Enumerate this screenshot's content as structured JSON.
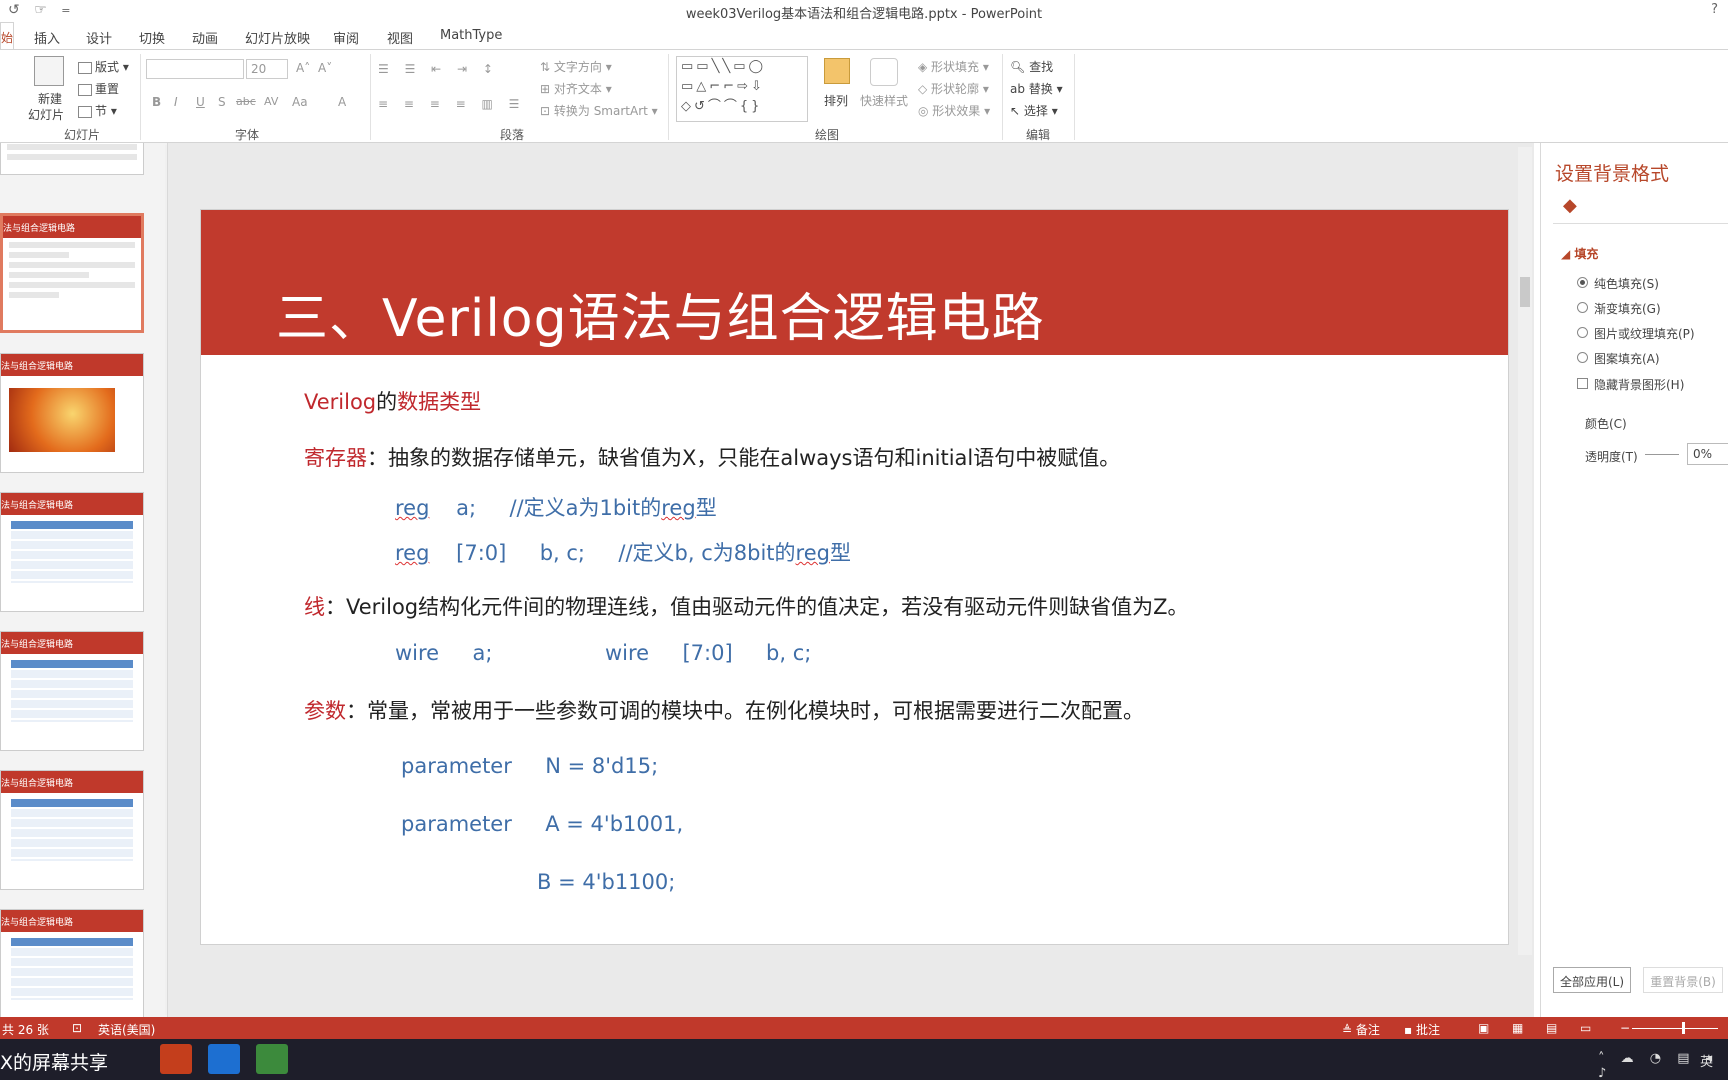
{
  "titlebar": {
    "undo": "↺",
    "quick": "☞",
    "more": "=",
    "title": "week03Verilog基本语法和组合逻辑电路.pptx - PowerPoint",
    "help": "?"
  },
  "tabs": [
    "插入",
    "设计",
    "切换",
    "动画",
    "幻灯片放映",
    "审阅",
    "视图",
    "MathType"
  ],
  "active_tab_fragment": "始",
  "ribbon": {
    "slides": {
      "new": "新建",
      "new2": "幻灯片",
      "layout": "版式",
      "reset": "重置",
      "section": "节",
      "label": "幻灯片"
    },
    "font": {
      "size": "20",
      "label": "字体",
      "bold": "B",
      "italic": "I",
      "underline": "U",
      "shadow": "S",
      "strike": "abc",
      "spacing": "AV",
      "case": "Aa",
      "color": "A",
      "grow": "A˄",
      "shrink": "A˅"
    },
    "paragraph": {
      "direction": "文字方向",
      "align": "对齐文本",
      "smartart": "转换为 SmartArt",
      "label": "段落"
    },
    "drawing": {
      "arrange": "排列",
      "quickstyle": "快速样式",
      "fill": "形状填充",
      "outline": "形状轮廓",
      "effect": "形状效果",
      "label": "绘图"
    },
    "editing": {
      "find": "查找",
      "replace": "替换",
      "select": "选择",
      "label": "编辑"
    }
  },
  "thumbs": {
    "title_frag": "法与组合逻辑电路"
  },
  "slide": {
    "title": "三、Verilog语法与组合逻辑电路",
    "heading_a": "Verilog",
    "heading_b": "的",
    "heading_c": "数据类型",
    "reg_label": "寄存器",
    "reg_desc": "：抽象的数据存储单元，缺省值为X，只能在always语句和initial语句中被赋值。",
    "reg1_kw": "reg",
    "reg1_rest": "    a;     //定义a为1bit的",
    "reg1_sq": "reg",
    "reg1_end": "型",
    "reg2_kw": "reg",
    "reg2_rest": "    [7:0]     b, c;     //定义b, c为8bit的",
    "reg2_sq": "reg",
    "reg2_end": "型",
    "wire_label": "线",
    "wire_desc": "：Verilog结构化元件间的物理连线，值由驱动元件的值决定，若没有驱动元件则缺省值为Z。",
    "wire_a": "wire     a;",
    "wire_b": "wire     [7:0]     b, c;",
    "param_label": "参数",
    "param_desc": "：常量，常被用于一些参数可调的模块中。在例化模块时，可根据需要进行二次配置。",
    "param1": "parameter     N = 8'd15;",
    "param2": "parameter     A = 4'b1001,",
    "param3": "B = 4'b1100;"
  },
  "pane": {
    "title": "设置背景格式",
    "fill": "填充",
    "opts": [
      "纯色填充(S)",
      "渐变填充(G)",
      "图片或纹理填充(P)",
      "图案填充(A)"
    ],
    "hide": "隐藏背景图形(H)",
    "color": "颜色(C)",
    "transparency": "透明度(T)",
    "trans_val": "0%",
    "apply_all": "全部应用(L)",
    "reset_bg": "重置背景(B)"
  },
  "status": {
    "slides": "共 26 张",
    "lang": "英语(美国)",
    "notes": "备注",
    "comments": "批注",
    "ime": "英"
  },
  "taskbar": {
    "share": "X的屏幕共享"
  }
}
